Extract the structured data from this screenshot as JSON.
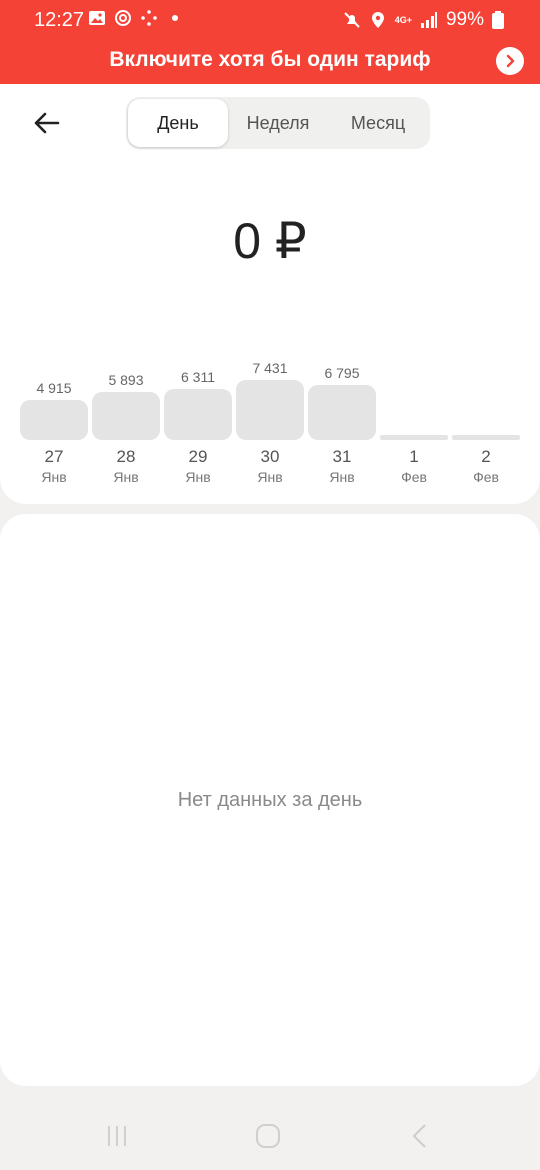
{
  "status_bar": {
    "time": "12:27",
    "network": "4G+",
    "battery": "99%"
  },
  "banner": {
    "text": "Включите хотя бы один тариф",
    "color": "#f44336"
  },
  "tabs": [
    {
      "label": "День",
      "active": true
    },
    {
      "label": "Неделя",
      "active": false
    },
    {
      "label": "Месяц",
      "active": false
    }
  ],
  "amount": "0 ₽",
  "chart_data": {
    "type": "bar",
    "categories": [
      "27 Янв",
      "28 Янв",
      "29 Янв",
      "30 Янв",
      "31 Янв",
      "1 Фев",
      "2 Фев"
    ],
    "days": [
      "27",
      "28",
      "29",
      "30",
      "31",
      "1",
      "2"
    ],
    "months": [
      "Янв",
      "Янв",
      "Янв",
      "Янв",
      "Янв",
      "Фев",
      "Фев"
    ],
    "values": [
      4915,
      5893,
      6311,
      7431,
      6795,
      0,
      0
    ],
    "value_labels": [
      "4 915",
      "5 893",
      "6 311",
      "7 431",
      "6 795",
      "",
      ""
    ]
  },
  "empty_state": "Нет данных за день"
}
